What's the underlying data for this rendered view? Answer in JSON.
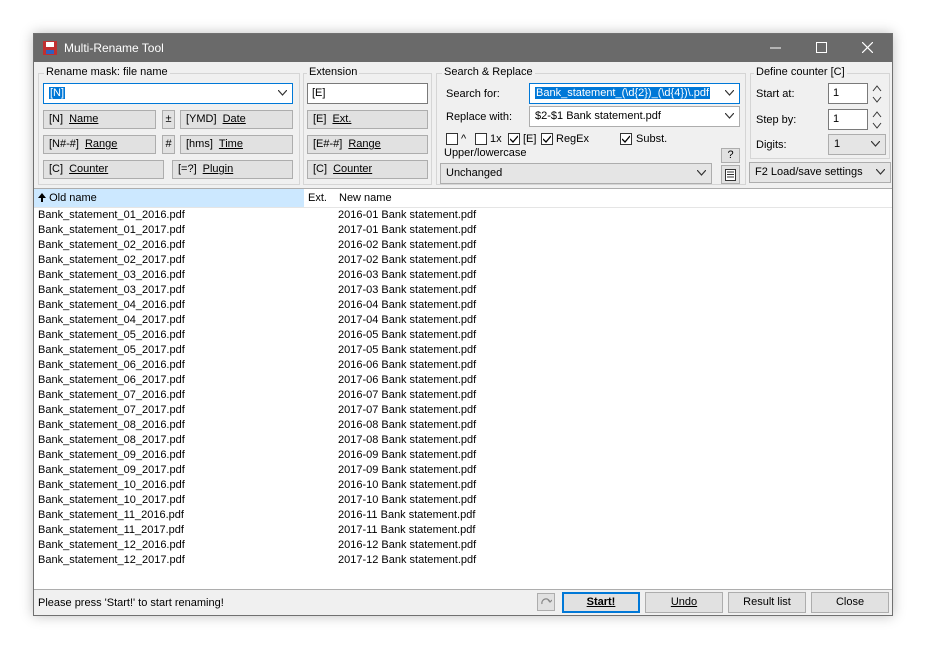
{
  "window": {
    "title": "Multi-Rename Tool"
  },
  "rename_mask": {
    "label": "Rename mask: file name",
    "value": "[N]",
    "b_name": {
      "prefix": "[N]",
      "label": "Name"
    },
    "b_plusminus": "±",
    "b_date": {
      "prefix": "[YMD]",
      "label": "Date"
    },
    "b_range": {
      "prefix": "[N#-#]",
      "label": "Range"
    },
    "b_hash": "#",
    "b_time": {
      "prefix": "[hms]",
      "label": "Time"
    },
    "b_counter": {
      "prefix": "[C]",
      "label": "Counter"
    },
    "b_plugin": {
      "prefix": "[=?]",
      "label": "Plugin"
    }
  },
  "extension": {
    "label": "Extension",
    "value": "[E]",
    "b_ext": {
      "prefix": "[E]",
      "label": "Ext."
    },
    "b_range": {
      "prefix": "[E#-#]",
      "label": "Range"
    },
    "b_counter": {
      "prefix": "[C]",
      "label": "Counter"
    }
  },
  "search_replace": {
    "label": "Search & Replace",
    "search_label": "Search for:",
    "search_value": "Bank_statement_(\\d{2})_(\\d{4})\\.pdf",
    "replace_label": "Replace with:",
    "replace_value": "$2-$1 Bank statement.pdf",
    "opt_caret": {
      "label": "^",
      "checked": false
    },
    "opt_once": {
      "label": "1x",
      "checked": false
    },
    "opt_ext": {
      "label": "[E]",
      "checked": true
    },
    "opt_regex": {
      "label": "RegEx",
      "checked": true
    },
    "opt_subst": {
      "label": "Subst.",
      "checked": true
    },
    "help": "?"
  },
  "case": {
    "label": "Upper/lowercase",
    "value": "Unchanged"
  },
  "counter": {
    "label": "Define counter [C]",
    "start_label": "Start at:",
    "start_value": "1",
    "step_label": "Step by:",
    "step_value": "1",
    "digits_label": "Digits:",
    "digits_value": "1"
  },
  "load_save": "F2 Load/save settings",
  "list": {
    "col_old": "Old name",
    "col_ext": "Ext.",
    "col_new": "New name",
    "rows": [
      [
        "Bank_statement_01_2016.pdf",
        "2016-01 Bank statement.pdf"
      ],
      [
        "Bank_statement_01_2017.pdf",
        "2017-01 Bank statement.pdf"
      ],
      [
        "Bank_statement_02_2016.pdf",
        "2016-02 Bank statement.pdf"
      ],
      [
        "Bank_statement_02_2017.pdf",
        "2017-02 Bank statement.pdf"
      ],
      [
        "Bank_statement_03_2016.pdf",
        "2016-03 Bank statement.pdf"
      ],
      [
        "Bank_statement_03_2017.pdf",
        "2017-03 Bank statement.pdf"
      ],
      [
        "Bank_statement_04_2016.pdf",
        "2016-04 Bank statement.pdf"
      ],
      [
        "Bank_statement_04_2017.pdf",
        "2017-04 Bank statement.pdf"
      ],
      [
        "Bank_statement_05_2016.pdf",
        "2016-05 Bank statement.pdf"
      ],
      [
        "Bank_statement_05_2017.pdf",
        "2017-05 Bank statement.pdf"
      ],
      [
        "Bank_statement_06_2016.pdf",
        "2016-06 Bank statement.pdf"
      ],
      [
        "Bank_statement_06_2017.pdf",
        "2017-06 Bank statement.pdf"
      ],
      [
        "Bank_statement_07_2016.pdf",
        "2016-07 Bank statement.pdf"
      ],
      [
        "Bank_statement_07_2017.pdf",
        "2017-07 Bank statement.pdf"
      ],
      [
        "Bank_statement_08_2016.pdf",
        "2016-08 Bank statement.pdf"
      ],
      [
        "Bank_statement_08_2017.pdf",
        "2017-08 Bank statement.pdf"
      ],
      [
        "Bank_statement_09_2016.pdf",
        "2016-09 Bank statement.pdf"
      ],
      [
        "Bank_statement_09_2017.pdf",
        "2017-09 Bank statement.pdf"
      ],
      [
        "Bank_statement_10_2016.pdf",
        "2016-10 Bank statement.pdf"
      ],
      [
        "Bank_statement_10_2017.pdf",
        "2017-10 Bank statement.pdf"
      ],
      [
        "Bank_statement_11_2016.pdf",
        "2016-11 Bank statement.pdf"
      ],
      [
        "Bank_statement_11_2017.pdf",
        "2017-11 Bank statement.pdf"
      ],
      [
        "Bank_statement_12_2016.pdf",
        "2016-12 Bank statement.pdf"
      ],
      [
        "Bank_statement_12_2017.pdf",
        "2017-12 Bank statement.pdf"
      ]
    ]
  },
  "status": "Please press 'Start!' to start renaming!",
  "actions": {
    "start": "Start!",
    "undo": "Undo",
    "result": "Result list",
    "close": "Close"
  }
}
